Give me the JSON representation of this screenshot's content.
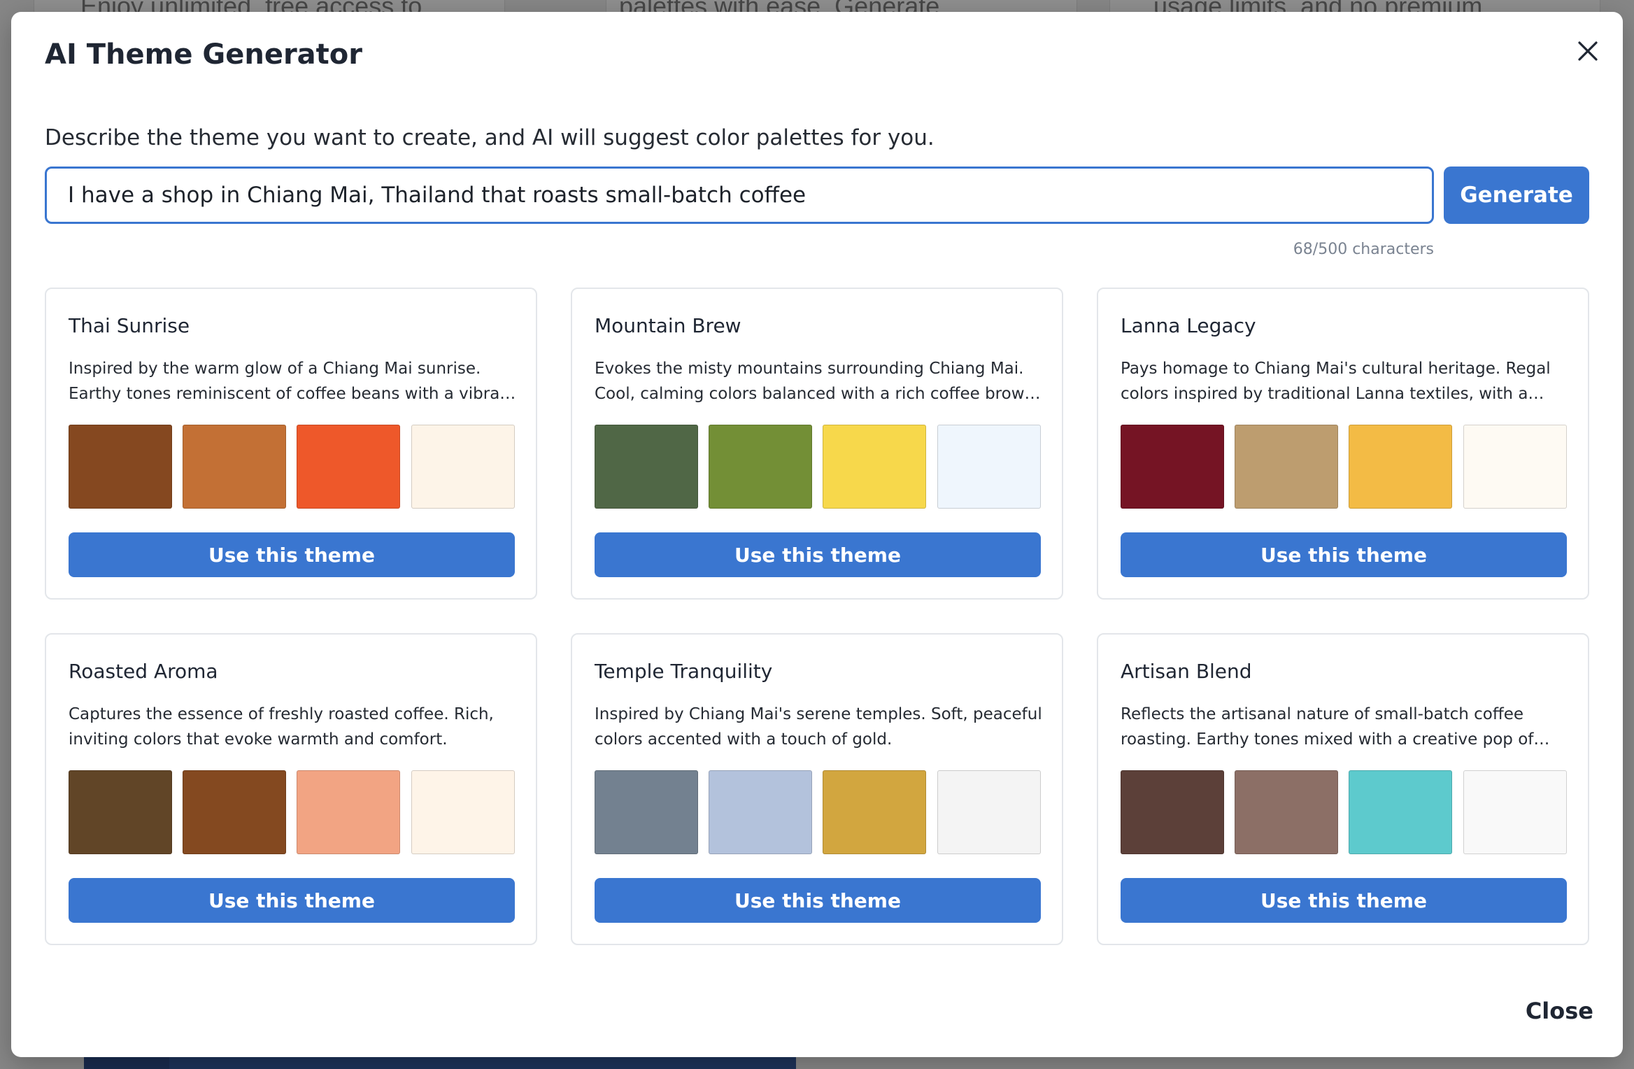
{
  "background": {
    "cards": [
      {
        "text": "Enjoy unlimited, free access to"
      },
      {
        "text": "palettes with ease. Generate"
      },
      {
        "text": "usage limits, and no premium"
      }
    ]
  },
  "modal": {
    "title": "AI Theme Generator",
    "description": "Describe the theme you want to create, and AI will suggest color palettes for you.",
    "prompt": {
      "value": "I have a shop in Chiang Mai, Thailand that roasts small-batch coffee",
      "placeholder": ""
    },
    "generate_label": "Generate",
    "char_count": "68/500 characters",
    "close_label": "Close",
    "close_icon": "close-icon"
  },
  "themes": [
    {
      "name": "Thai Sunrise",
      "description": "Inspired by the warm glow of a Chiang Mai sunrise. Earthy tones reminiscent of coffee beans with a vibrant orange accent.",
      "colors": [
        "#854820",
        "#C37035",
        "#EE582A",
        "#FDF4E8"
      ],
      "button_label": "Use this theme"
    },
    {
      "name": "Mountain Brew",
      "description": "Evokes the misty mountains surrounding Chiang Mai. Cool, calming colors balanced with a rich coffee brown tone.",
      "colors": [
        "#506746",
        "#738F36",
        "#F7D84B",
        "#EFF6FD"
      ],
      "button_label": "Use this theme"
    },
    {
      "name": "Lanna Legacy",
      "description": "Pays homage to Chiang Mai's cultural heritage. Regal colors inspired by traditional Lanna textiles, with a golden accent.",
      "colors": [
        "#751424",
        "#BD9D6F",
        "#F3BB45",
        "#FEFAF3"
      ],
      "button_label": "Use this theme"
    },
    {
      "name": "Roasted Aroma",
      "description": "Captures the essence of freshly roasted coffee. Rich, inviting colors that evoke warmth and comfort.",
      "colors": [
        "#614527",
        "#844920",
        "#F2A483",
        "#FEF4E8"
      ],
      "button_label": "Use this theme"
    },
    {
      "name": "Temple Tranquility",
      "description": "Inspired by Chiang Mai's serene temples. Soft, peaceful colors accented with a touch of gold.",
      "colors": [
        "#738190",
        "#B3C2DC",
        "#D2A63F",
        "#F4F4F4"
      ],
      "button_label": "Use this theme"
    },
    {
      "name": "Artisan Blend",
      "description": "Reflects the artisanal nature of small-batch coffee roasting. Earthy tones mixed with a creative pop of color.",
      "colors": [
        "#5C4039",
        "#8C6F66",
        "#5DCACD",
        "#F9F9F9"
      ],
      "button_label": "Use this theme"
    }
  ],
  "colors": {
    "accent": "#3A76D0",
    "overlay": "#878787",
    "card_border": "#E3E6EA"
  }
}
